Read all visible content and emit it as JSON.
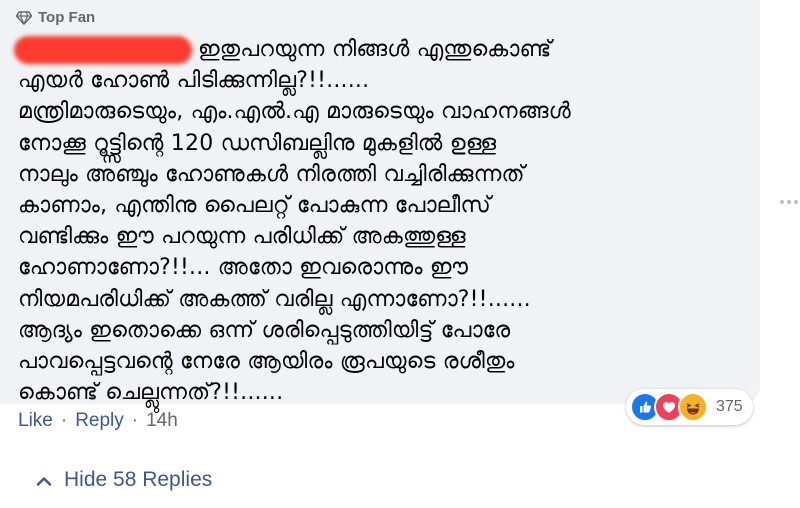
{
  "comment": {
    "badge_label": "Top Fan",
    "lines": [
      "ഇതുപറയുന്ന നിങ്ങൾ എന്തുകൊണ്ട്",
      "എയർ ഹോൺ പിടിക്കുന്നില്ല?!!......",
      "മന്ത്രിമാരുടെയും, എം.എൽ.എ മാരുടെയും വാഹനങ്ങൾ",
      "നോക്കൂ റൂട്ട്സിന്റെ 120 ഡസിബല്ലിനു മുകളിൽ ഉള്ള",
      "നാലും അഞ്ചും ഹോണുകൾ നിരത്തി വച്ചിരിക്കുന്നത്",
      "കാണാം, എന്തിനു പൈലറ്റ് പോകുന്ന പോലീസ്",
      "വണ്ടിക്കും ഈ പറയുന്ന പരിധിക്ക് അകത്തുള്ള",
      "ഹോണാണോ?!!... അതോ ഇവരൊന്നും ഈ",
      "നിയമപരിധിക്ക് അകത്ത് വരില്ല എന്നാണോ?!!......",
      "ആദ്യം ഇതൊക്കെ ഒന്ന് ശരിപ്പെടുത്തിയിട്ട് പോരേ",
      "പാവപ്പെട്ടവന്റെ നേരേ ആയിരം രൂപയുടെ രശീതും",
      "കൊണ്ട് ചെല്ലുന്നത്?!!......"
    ],
    "reaction_icons": [
      "like-icon",
      "love-icon",
      "haha-icon"
    ],
    "reaction_count": "375"
  },
  "actions": {
    "like_label": "Like",
    "separator": "·",
    "reply_label": "Reply",
    "time": "14h"
  },
  "replies": {
    "hide_label": "Hide 58 Replies"
  },
  "colors": {
    "bubble_bg": "#f0f2f5",
    "text": "#050505",
    "secondary": "#65676b",
    "link": "#385898",
    "like_blue": "#1877f2",
    "love_red": "#f33e58",
    "haha_yellow": "#f7b125"
  }
}
